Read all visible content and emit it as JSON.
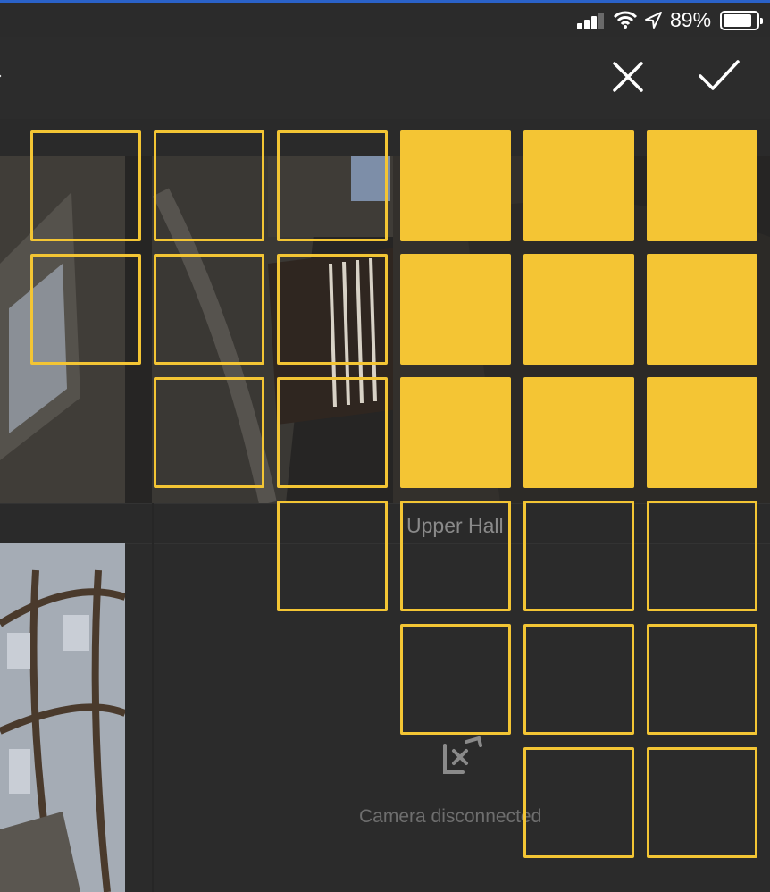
{
  "status_bar": {
    "battery_percent": "89%",
    "signal_bars": 3,
    "icons": [
      "signal-icon",
      "wifi-icon",
      "location-arrow-icon",
      "battery-icon"
    ]
  },
  "toolbar": {
    "close_icon": "close-icon",
    "confirm_icon": "checkmark-icon"
  },
  "camera": {
    "name": "Upper Hall",
    "disconnected_text": "Camera disconnected",
    "disconnected_icon": "camera-disconnected-icon"
  },
  "zone_grid": {
    "accent_color": "#f4c534",
    "rows": [
      [
        false,
        false,
        false,
        true,
        true,
        true
      ],
      [
        false,
        false,
        false,
        true,
        true,
        true
      ],
      [
        null,
        false,
        false,
        true,
        true,
        true
      ],
      [
        null,
        null,
        false,
        false,
        false,
        false
      ],
      [
        null,
        null,
        null,
        false,
        false,
        false
      ],
      [
        null,
        null,
        null,
        null,
        false,
        false
      ]
    ]
  }
}
